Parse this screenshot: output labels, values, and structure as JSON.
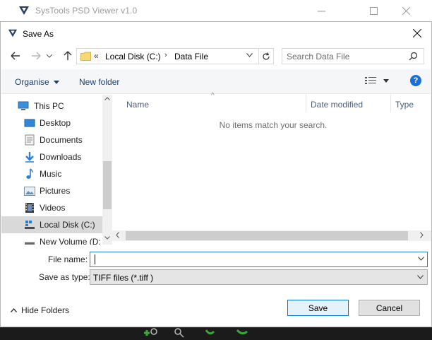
{
  "app": {
    "title": "SysTools PSD Viewer v1.0"
  },
  "dialog": {
    "title": "Save As",
    "address": {
      "overflow": "«",
      "crumbs": [
        "Local Disk (C:)",
        "Data File"
      ]
    },
    "search": {
      "placeholder": "Search Data File"
    },
    "toolbar": {
      "organise_label": "Organise",
      "new_folder_label": "New folder",
      "help_label": "?"
    },
    "nav": {
      "items": [
        {
          "label": "This PC",
          "icon": "this-pc-icon"
        },
        {
          "label": "Desktop",
          "icon": "desktop-icon"
        },
        {
          "label": "Documents",
          "icon": "documents-icon"
        },
        {
          "label": "Downloads",
          "icon": "downloads-icon"
        },
        {
          "label": "Music",
          "icon": "music-icon"
        },
        {
          "label": "Pictures",
          "icon": "pictures-icon"
        },
        {
          "label": "Videos",
          "icon": "videos-icon"
        },
        {
          "label": "Local Disk (C:)",
          "icon": "drive-icon",
          "selected": true
        },
        {
          "label": "New Volume (D:",
          "icon": "drive-icon"
        }
      ]
    },
    "filelist": {
      "columns": [
        "Name",
        "Date modified",
        "Type"
      ],
      "empty_message": "No items match your search."
    },
    "file_name": {
      "label": "File name:",
      "value": ""
    },
    "save_as_type": {
      "label": "Save as type:",
      "value": "TIFF  files (*.tiff )"
    },
    "hide_folders_label": "Hide Folders",
    "save_label": "Save",
    "cancel_label": "Cancel"
  },
  "colors": {
    "accent": "#0078d7",
    "link": "#1e3f66",
    "selected_bg": "#d9d9d9",
    "help": "#1a6fd6"
  }
}
